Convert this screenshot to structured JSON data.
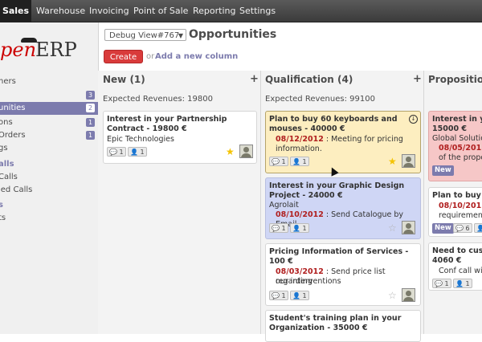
{
  "topbar": {
    "items": [
      "Sales",
      "Warehouse",
      "Invoicing",
      "Point of Sale",
      "Reporting",
      "Settings"
    ]
  },
  "logo": {
    "part1": "pen",
    "part2": "ERP"
  },
  "sidebar": {
    "rows": [
      {
        "label": "ners",
        "badge": ""
      },
      {
        "label": "",
        "badge": "3"
      },
      {
        "label": "unities",
        "badge": "2"
      },
      {
        "label": "ons",
        "badge": "1"
      },
      {
        "label": "Orders",
        "badge": "1"
      },
      {
        "label": "gs",
        "badge": ""
      },
      {
        "label": "alls",
        "badge": ""
      },
      {
        "label": "Calls",
        "badge": ""
      },
      {
        "label": "led Calls",
        "badge": ""
      },
      {
        "label": "s",
        "badge": ""
      },
      {
        "label": "ts",
        "badge": ""
      }
    ]
  },
  "view": {
    "select_value": "Debug View#767",
    "title": "Opportunities",
    "create_label": "Create",
    "or_label": "or",
    "add_column_label": "Add a new column"
  },
  "columns": [
    {
      "title": "New  (1)",
      "revenue": "Expected Revenues: 19800",
      "cards": [
        {
          "title1": "Interest in your Partnership",
          "title2": "Contract - 19800 €",
          "line": "Epic Technologies",
          "chips": [
            "1",
            "1"
          ]
        }
      ]
    },
    {
      "title": "Qualification  (4)",
      "revenue": "Expected Revenues: 99100",
      "cards": [
        {
          "title1": "Plan to buy 60 keyboards and",
          "title2": "mouses - 40000 €",
          "date": "08/12/2012",
          "text1": " : Meeting for pricing",
          "text2": "information.",
          "chips": [
            "1",
            "1"
          ]
        },
        {
          "title1": "Interest in your Graphic Design",
          "title2": "Project - 24000 €",
          "line": "Agrolait",
          "date": "08/10/2012",
          "text1": " : Send Catalogue by Email",
          "chips": [
            "1",
            "1"
          ]
        },
        {
          "title1": "Pricing Information of Services -",
          "title2": "100 €",
          "date": "08/03/2012",
          "text1": " : Send price list regarding",
          "text2": "our interventions",
          "chips": [
            "1",
            "1"
          ]
        },
        {
          "title1": "Student's training plan in your",
          "title2": "Organization - 35000 €"
        }
      ]
    },
    {
      "title": "Proposition",
      "cards": [
        {
          "title1": "Interest in your",
          "title2": "15000 €",
          "line": "Global Solution",
          "date": "08/05/2012",
          "text2": "of the propos",
          "new": "New"
        },
        {
          "title1": "Plan to buy a",
          "date": "08/10/2012",
          "text2": "requirement",
          "new": "New",
          "chips": [
            "6",
            "1"
          ]
        },
        {
          "title1": "Need to custo",
          "title2": "4060 €",
          "text2": "Conf call with",
          "chips": [
            "1",
            "1"
          ]
        }
      ]
    }
  ]
}
